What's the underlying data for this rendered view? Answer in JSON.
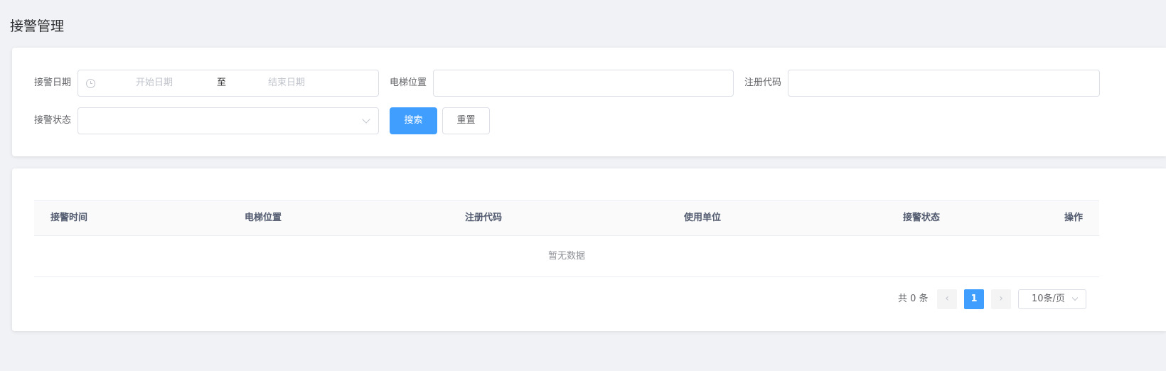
{
  "page": {
    "title": "接警管理"
  },
  "search_form": {
    "date_label": "接警日期",
    "date_start_placeholder": "开始日期",
    "date_separator": "至",
    "date_end_placeholder": "结束日期",
    "location_label": "电梯位置",
    "location_value": "",
    "code_label": "注册代码",
    "code_value": "",
    "status_label": "接警状态",
    "status_value": "",
    "search_button": "搜索",
    "reset_button": "重置"
  },
  "table": {
    "columns": [
      "接警时间",
      "电梯位置",
      "注册代码",
      "使用单位",
      "接警状态",
      "操作"
    ],
    "rows": [],
    "empty_text": "暂无数据"
  },
  "pagination": {
    "total_text": "共 0 条",
    "prev_icon": "‹",
    "next_icon": "›",
    "current_page": "1",
    "page_size": "10条/页"
  },
  "colors": {
    "primary": "#409eff",
    "background": "#f0f2f5"
  }
}
